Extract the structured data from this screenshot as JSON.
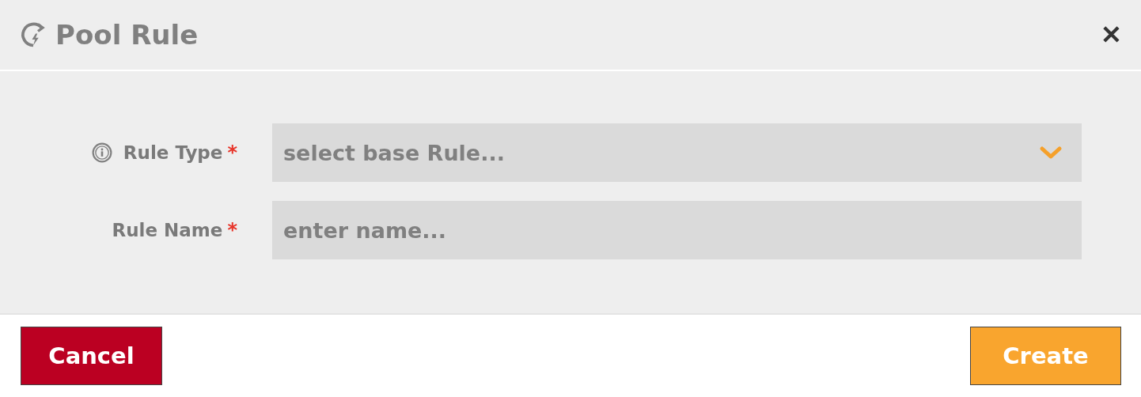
{
  "dialog": {
    "title": "Pool Rule",
    "close": "✕"
  },
  "fields": [
    {
      "kind": "select",
      "label": "Rule Type",
      "info": true,
      "required_mark": "*",
      "placeholder": "select base Rule..."
    },
    {
      "kind": "text",
      "label": "Rule Name",
      "info": false,
      "required_mark": "*",
      "placeholder": "enter name..."
    }
  ],
  "buttons": [
    {
      "label": "Cancel",
      "kind": "danger"
    },
    {
      "label": "Create",
      "kind": "primary"
    }
  ]
}
